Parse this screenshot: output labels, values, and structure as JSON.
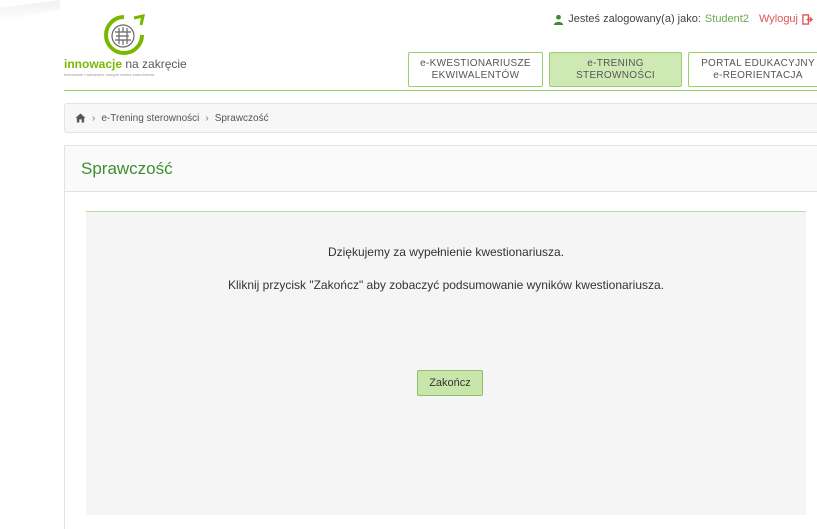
{
  "user_bar": {
    "logged_in_text": "Jesteś zalogowany(a) jako:",
    "username": "Student2",
    "logout_label": "Wyloguj"
  },
  "logo": {
    "brand_bold": "innowacje",
    "brand_rest": "na zakręcie",
    "tagline": "testowanie i wdrażanie nowych metod zatrudnienia"
  },
  "top_nav": [
    {
      "line1": "e-KWESTIONARIUSZE",
      "line2": "EKWIWALENTÓW",
      "active": false
    },
    {
      "line1": "e-TRENING",
      "line2": "STEROWNOŚCI",
      "active": true
    },
    {
      "line1": "PORTAL EDUKACYJNY",
      "line2": "e-REORIENTACJA",
      "active": false
    }
  ],
  "breadcrumb": {
    "home_icon": "home-icon",
    "items": [
      "e-Trening sterowności",
      "Sprawczość"
    ]
  },
  "panel": {
    "title": "Sprawczość",
    "message_1": "Dziękujemy za wypełnienie kwestionariusza.",
    "message_2": "Kliknij przycisk \"Zakończ\" aby zobaczyć podsumowanie wyników kwestionariusza.",
    "finish_button": "Zakończ"
  },
  "colors": {
    "accent_green": "#7ab800",
    "title_green": "#3e8e2f",
    "button_green": "#c8e6a9",
    "logout_red": "#e05555"
  }
}
